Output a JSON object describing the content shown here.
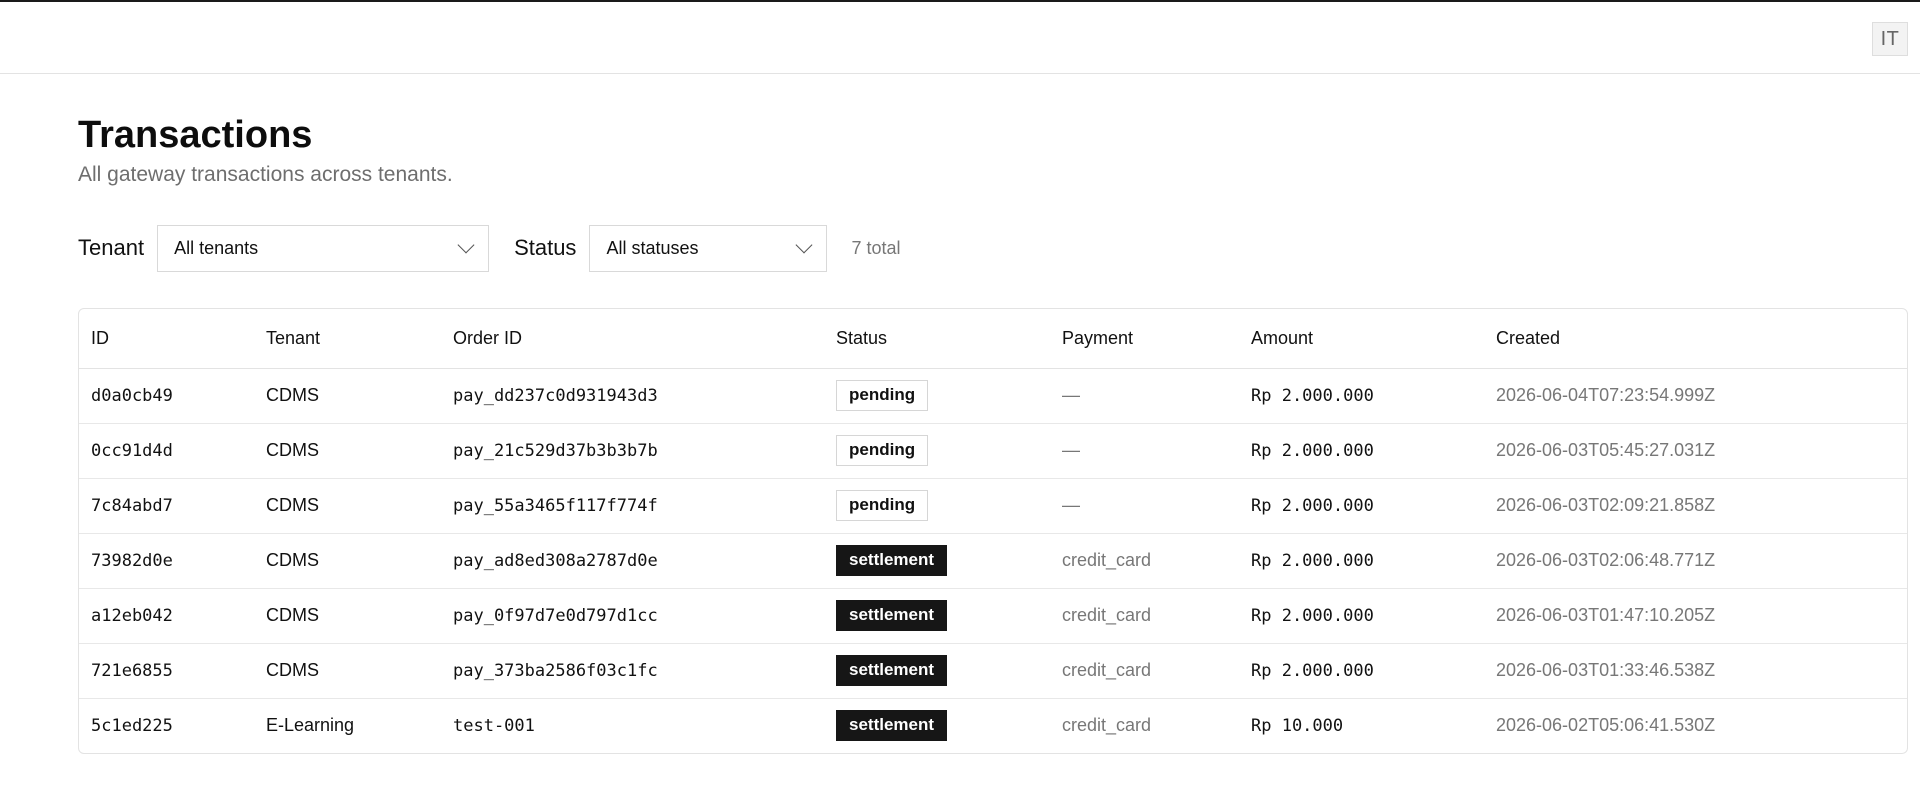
{
  "header": {
    "avatar_initials": "IT"
  },
  "page": {
    "title": "Transactions",
    "subtitle": "All gateway transactions across tenants."
  },
  "filters": {
    "tenant_label": "Tenant",
    "tenant_value": "All tenants",
    "status_label": "Status",
    "status_value": "All statuses",
    "total": "7 total"
  },
  "table": {
    "columns": [
      "ID",
      "Tenant",
      "Order ID",
      "Status",
      "Payment",
      "Amount",
      "Created"
    ],
    "rows": [
      {
        "id": "d0a0cb49",
        "tenant": "CDMS",
        "order_id": "pay_dd237c0d931943d3",
        "status": "pending",
        "payment": "—",
        "amount": "Rp 2.000.000",
        "created": "2026-06-04T07:23:54.999Z"
      },
      {
        "id": "0cc91d4d",
        "tenant": "CDMS",
        "order_id": "pay_21c529d37b3b3b7b",
        "status": "pending",
        "payment": "—",
        "amount": "Rp 2.000.000",
        "created": "2026-06-03T05:45:27.031Z"
      },
      {
        "id": "7c84abd7",
        "tenant": "CDMS",
        "order_id": "pay_55a3465f117f774f",
        "status": "pending",
        "payment": "—",
        "amount": "Rp 2.000.000",
        "created": "2026-06-03T02:09:21.858Z"
      },
      {
        "id": "73982d0e",
        "tenant": "CDMS",
        "order_id": "pay_ad8ed308a2787d0e",
        "status": "settlement",
        "payment": "credit_card",
        "amount": "Rp 2.000.000",
        "created": "2026-06-03T02:06:48.771Z"
      },
      {
        "id": "a12eb042",
        "tenant": "CDMS",
        "order_id": "pay_0f97d7e0d797d1cc",
        "status": "settlement",
        "payment": "credit_card",
        "amount": "Rp 2.000.000",
        "created": "2026-06-03T01:47:10.205Z"
      },
      {
        "id": "721e6855",
        "tenant": "CDMS",
        "order_id": "pay_373ba2586f03c1fc",
        "status": "settlement",
        "payment": "credit_card",
        "amount": "Rp 2.000.000",
        "created": "2026-06-03T01:33:46.538Z"
      },
      {
        "id": "5c1ed225",
        "tenant": "E-Learning",
        "order_id": "test-001",
        "status": "settlement",
        "payment": "credit_card",
        "amount": "Rp 10.000",
        "created": "2026-06-02T05:06:41.530Z"
      }
    ]
  },
  "colors": {
    "settlement_badge_bg": "#161616",
    "pending_badge_border": "#d6d6d6",
    "muted_text": "#777777"
  }
}
